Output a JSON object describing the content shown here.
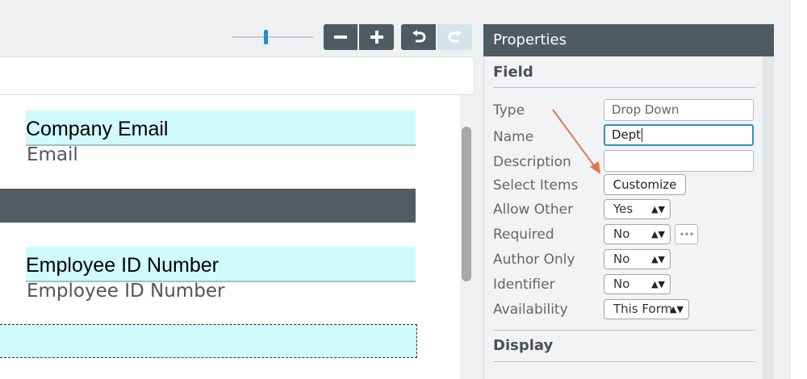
{
  "toolbar": {
    "zoom_out_label": "−",
    "zoom_in_label": "+",
    "undo_label": "↶",
    "redo_label": "↷"
  },
  "canvas": {
    "fields": [
      {
        "label": "Company Email",
        "sublabel": "Email"
      },
      {
        "label": "Employee ID Number",
        "sublabel": "Employee ID Number"
      }
    ]
  },
  "properties": {
    "title": "Properties",
    "field_section": "Field",
    "display_section": "Display",
    "rows": {
      "type": {
        "label": "Type",
        "value": "Drop Down"
      },
      "name": {
        "label": "Name",
        "value": "Dept"
      },
      "description": {
        "label": "Description",
        "value": ""
      },
      "select_items": {
        "label": "Select Items",
        "button": "Customize"
      },
      "allow_other": {
        "label": "Allow Other",
        "value": "Yes"
      },
      "required": {
        "label": "Required",
        "value": "No",
        "more": "•••"
      },
      "author_only": {
        "label": "Author Only",
        "value": "No"
      },
      "identifier": {
        "label": "Identifier",
        "value": "No"
      },
      "availability": {
        "label": "Availability",
        "value": "This Form"
      }
    }
  },
  "colors": {
    "accent": "#1f8fd1",
    "header": "#4f5b62",
    "field_highlight": "#d0fafc",
    "annotation_arrow": "#e07a50"
  }
}
